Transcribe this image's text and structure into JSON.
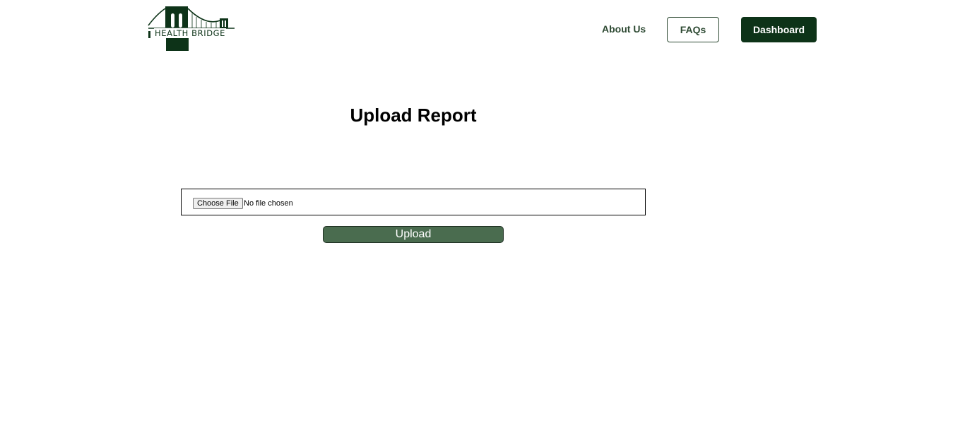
{
  "header": {
    "logo_text": "HEALTH BRIDGE",
    "nav": {
      "about_label": "About Us",
      "faqs_label": "FAQs",
      "dashboard_label": "Dashboard"
    }
  },
  "main": {
    "title": "Upload Report",
    "file_input": {
      "button_label": "Choose File",
      "status_text": "No file chosen"
    },
    "upload_label": "Upload"
  },
  "colors": {
    "brand_dark_green": "#0d3318",
    "nav_text_green": "#2e4a33",
    "upload_button_green": "#4a6c4f"
  },
  "icons": {
    "logo": "brooklyn-bridge-logo-icon"
  }
}
